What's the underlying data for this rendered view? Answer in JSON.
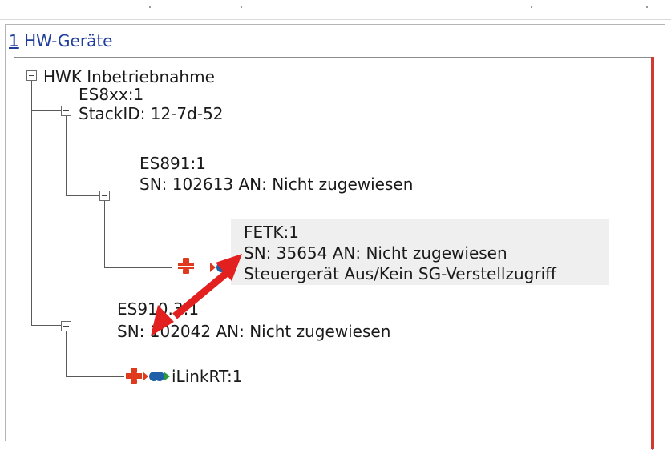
{
  "panel": {
    "title_accel": "1",
    "title_rest": " HW-Geräte"
  },
  "tree": {
    "root": {
      "label": "HWK Inbetriebnahme"
    },
    "es8": {
      "line1": "ES8xx:1",
      "line2": "StackID: 12-7d-52"
    },
    "es891": {
      "line1": "ES891:1",
      "line2": "SN: 102613 AN: Nicht zugewiesen"
    },
    "fetk": {
      "line1": "FETK:1",
      "line2": "SN: 35654 AN: Nicht zugewiesen",
      "line3": "Steuergerät Aus/Kein SG-Verstellzugriff"
    },
    "es910": {
      "line1": "ES910.3:1",
      "line2": "SN: 102042 AN: Nicht zugewiesen"
    },
    "ilink": {
      "line1": "iLinkRT:1"
    }
  },
  "icons": {
    "device": "disconnected-device-icon",
    "link": "link-status-icon"
  },
  "colors": {
    "title": "#1f3e9c",
    "device_icon": "#e03a1e",
    "link_blue": "#1f5fa8",
    "link_green": "#2a9a3a",
    "annotation_arrow": "#e32020",
    "highlight_row": "#efefef"
  }
}
